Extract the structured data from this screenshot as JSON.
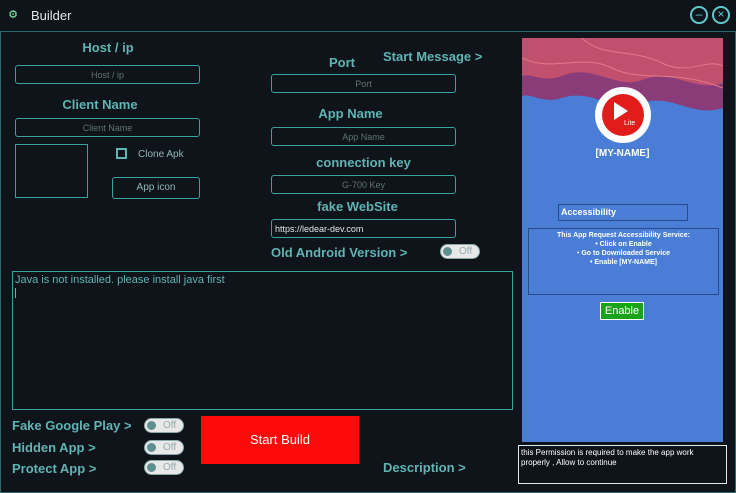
{
  "window": {
    "title": "Builder",
    "minimize_icon": "minimize-icon",
    "close_icon": "close-icon"
  },
  "left": {
    "host_label": "Host / ip",
    "host_placeholder": "Host / ip",
    "client_label": "Client Name",
    "client_placeholder": "Client Name",
    "clone_label": "Clone Apk",
    "app_icon_button": "App icon"
  },
  "middle": {
    "port_label": "Port",
    "port_placeholder": "Port",
    "start_message": "Start Message >",
    "appname_label": "App Name",
    "appname_placeholder": "App Name",
    "key_label": "connection key",
    "key_placeholder": "G-700 Key",
    "website_label": "fake WebSite",
    "website_value": "https://ledear-dev.com",
    "old_android_label": "Old Android Version  >",
    "old_android_toggle": "Off"
  },
  "console": {
    "text": "Java is not installed. please install java first"
  },
  "bottom": {
    "fake_google_label": "Fake Google Play  >",
    "fake_google_toggle": "Off",
    "hidden_app_label": "Hidden App  >",
    "hidden_app_toggle": "Off",
    "protect_app_label": "Protect App >",
    "protect_app_toggle": "Off",
    "start_build": "Start Build",
    "description": "Description >"
  },
  "preview": {
    "app_badge": "Lite",
    "app_name": "[MY-NAME]",
    "accessibility": "Accessibility",
    "permission_lines": [
      "This App Request Accessibility Service:",
      "• Click on Enable",
      "• Go to Downloaded Service",
      "• Enable [MY-NAME]"
    ],
    "enable_button": "Enable",
    "colors": {
      "bg": "#4a7ed6",
      "wave1": "#c0506e",
      "wave2": "#8a3c78",
      "enable": "#1aa31a"
    }
  },
  "note": {
    "text": "this Permission is required to make the app work properly , Allow to continue"
  }
}
